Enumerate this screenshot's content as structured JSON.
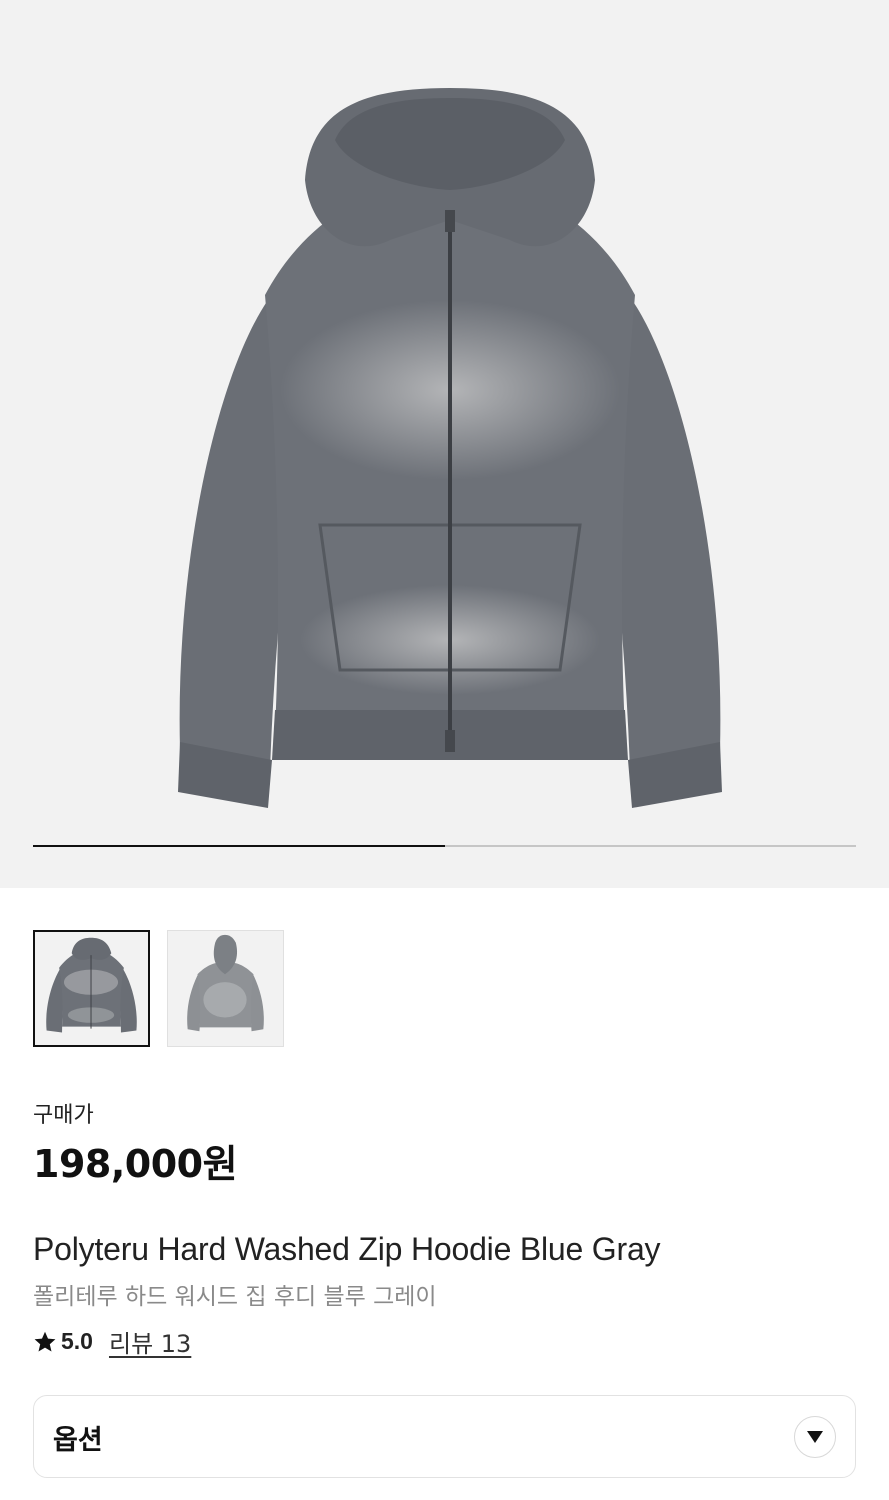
{
  "gallery": {
    "current_index": 1,
    "total_images": 2,
    "progress_fraction": 0.5
  },
  "product": {
    "price_label": "구매가",
    "price": "198,000원",
    "name_en": "Polyteru Hard Washed Zip Hoodie Blue Gray",
    "name_ko": "폴리테루 하드 워시드 집 후디 블루 그레이",
    "rating": "5.0",
    "review_text": "리뷰 13"
  },
  "options": {
    "label": "옵션"
  },
  "icons": {
    "rating": "star-icon",
    "option_toggle": "chevron-down-icon"
  },
  "colors": {
    "hoodie": "#6b6f76",
    "hoodie_wash": "#a9abae",
    "hero_bg": "#f2f2f2",
    "text_primary": "#111111",
    "text_secondary": "#8a8a8a"
  }
}
